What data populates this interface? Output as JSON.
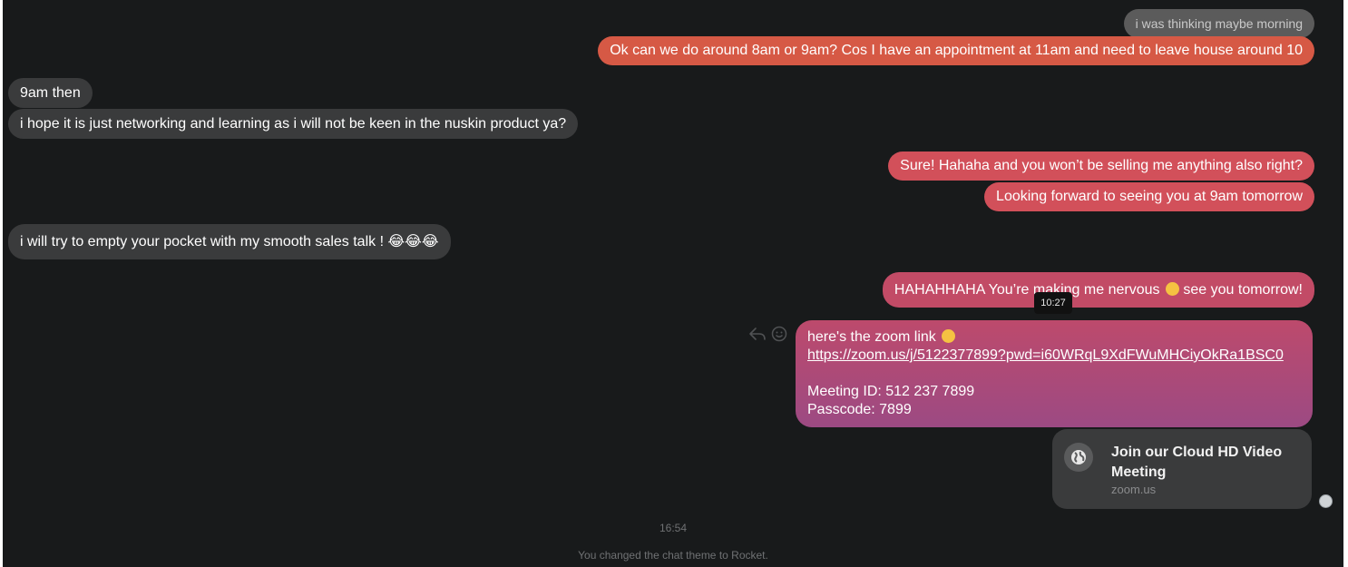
{
  "messages": {
    "m1": "i was thinking maybe morning",
    "m2": "Ok can we do around 8am or 9am? Cos I have an appointment at 11am and need to leave house around 10",
    "m3": "9am then",
    "m4": "i hope it is just networking and learning as i will not be keen in the nuskin product  ya?",
    "m5": "Sure! Hahaha and you won’t be selling me anything also right?",
    "m6": "Looking forward to seeing you at 9am tomorrow",
    "m7": "i will try to empty your pocket with my smooth sales talk ! 😂😂😂",
    "m8_before": "HAHAHHAHA You’re making me nervous",
    "m8_after": "see you tomorrow!",
    "zoom": {
      "intro": "here's the zoom link",
      "link": "https://zoom.us/j/5122377899?pwd=i60WRqL9XdFWuMHCiyOkRa1BSC0",
      "meeting_id": "Meeting ID: 512 237 7899",
      "passcode": "Passcode: 7899"
    }
  },
  "tooltip_time": "10:27",
  "link_card": {
    "title": "Join our Cloud HD Video Meeting",
    "domain": "zoom.us"
  },
  "footer": {
    "timestamp": "16:54",
    "system_message": "You changed the chat theme to Rocket."
  },
  "icons": [
    "reply-icon",
    "reaction-icon",
    "globe-icon",
    "avatar"
  ],
  "colors": {
    "background": "#181a1b",
    "incoming_bubble": "#3a3b3c",
    "outgoing_orange": "#d65945",
    "outgoing_pink": "#c24b66",
    "outgoing_purple": "#9c4a83"
  }
}
